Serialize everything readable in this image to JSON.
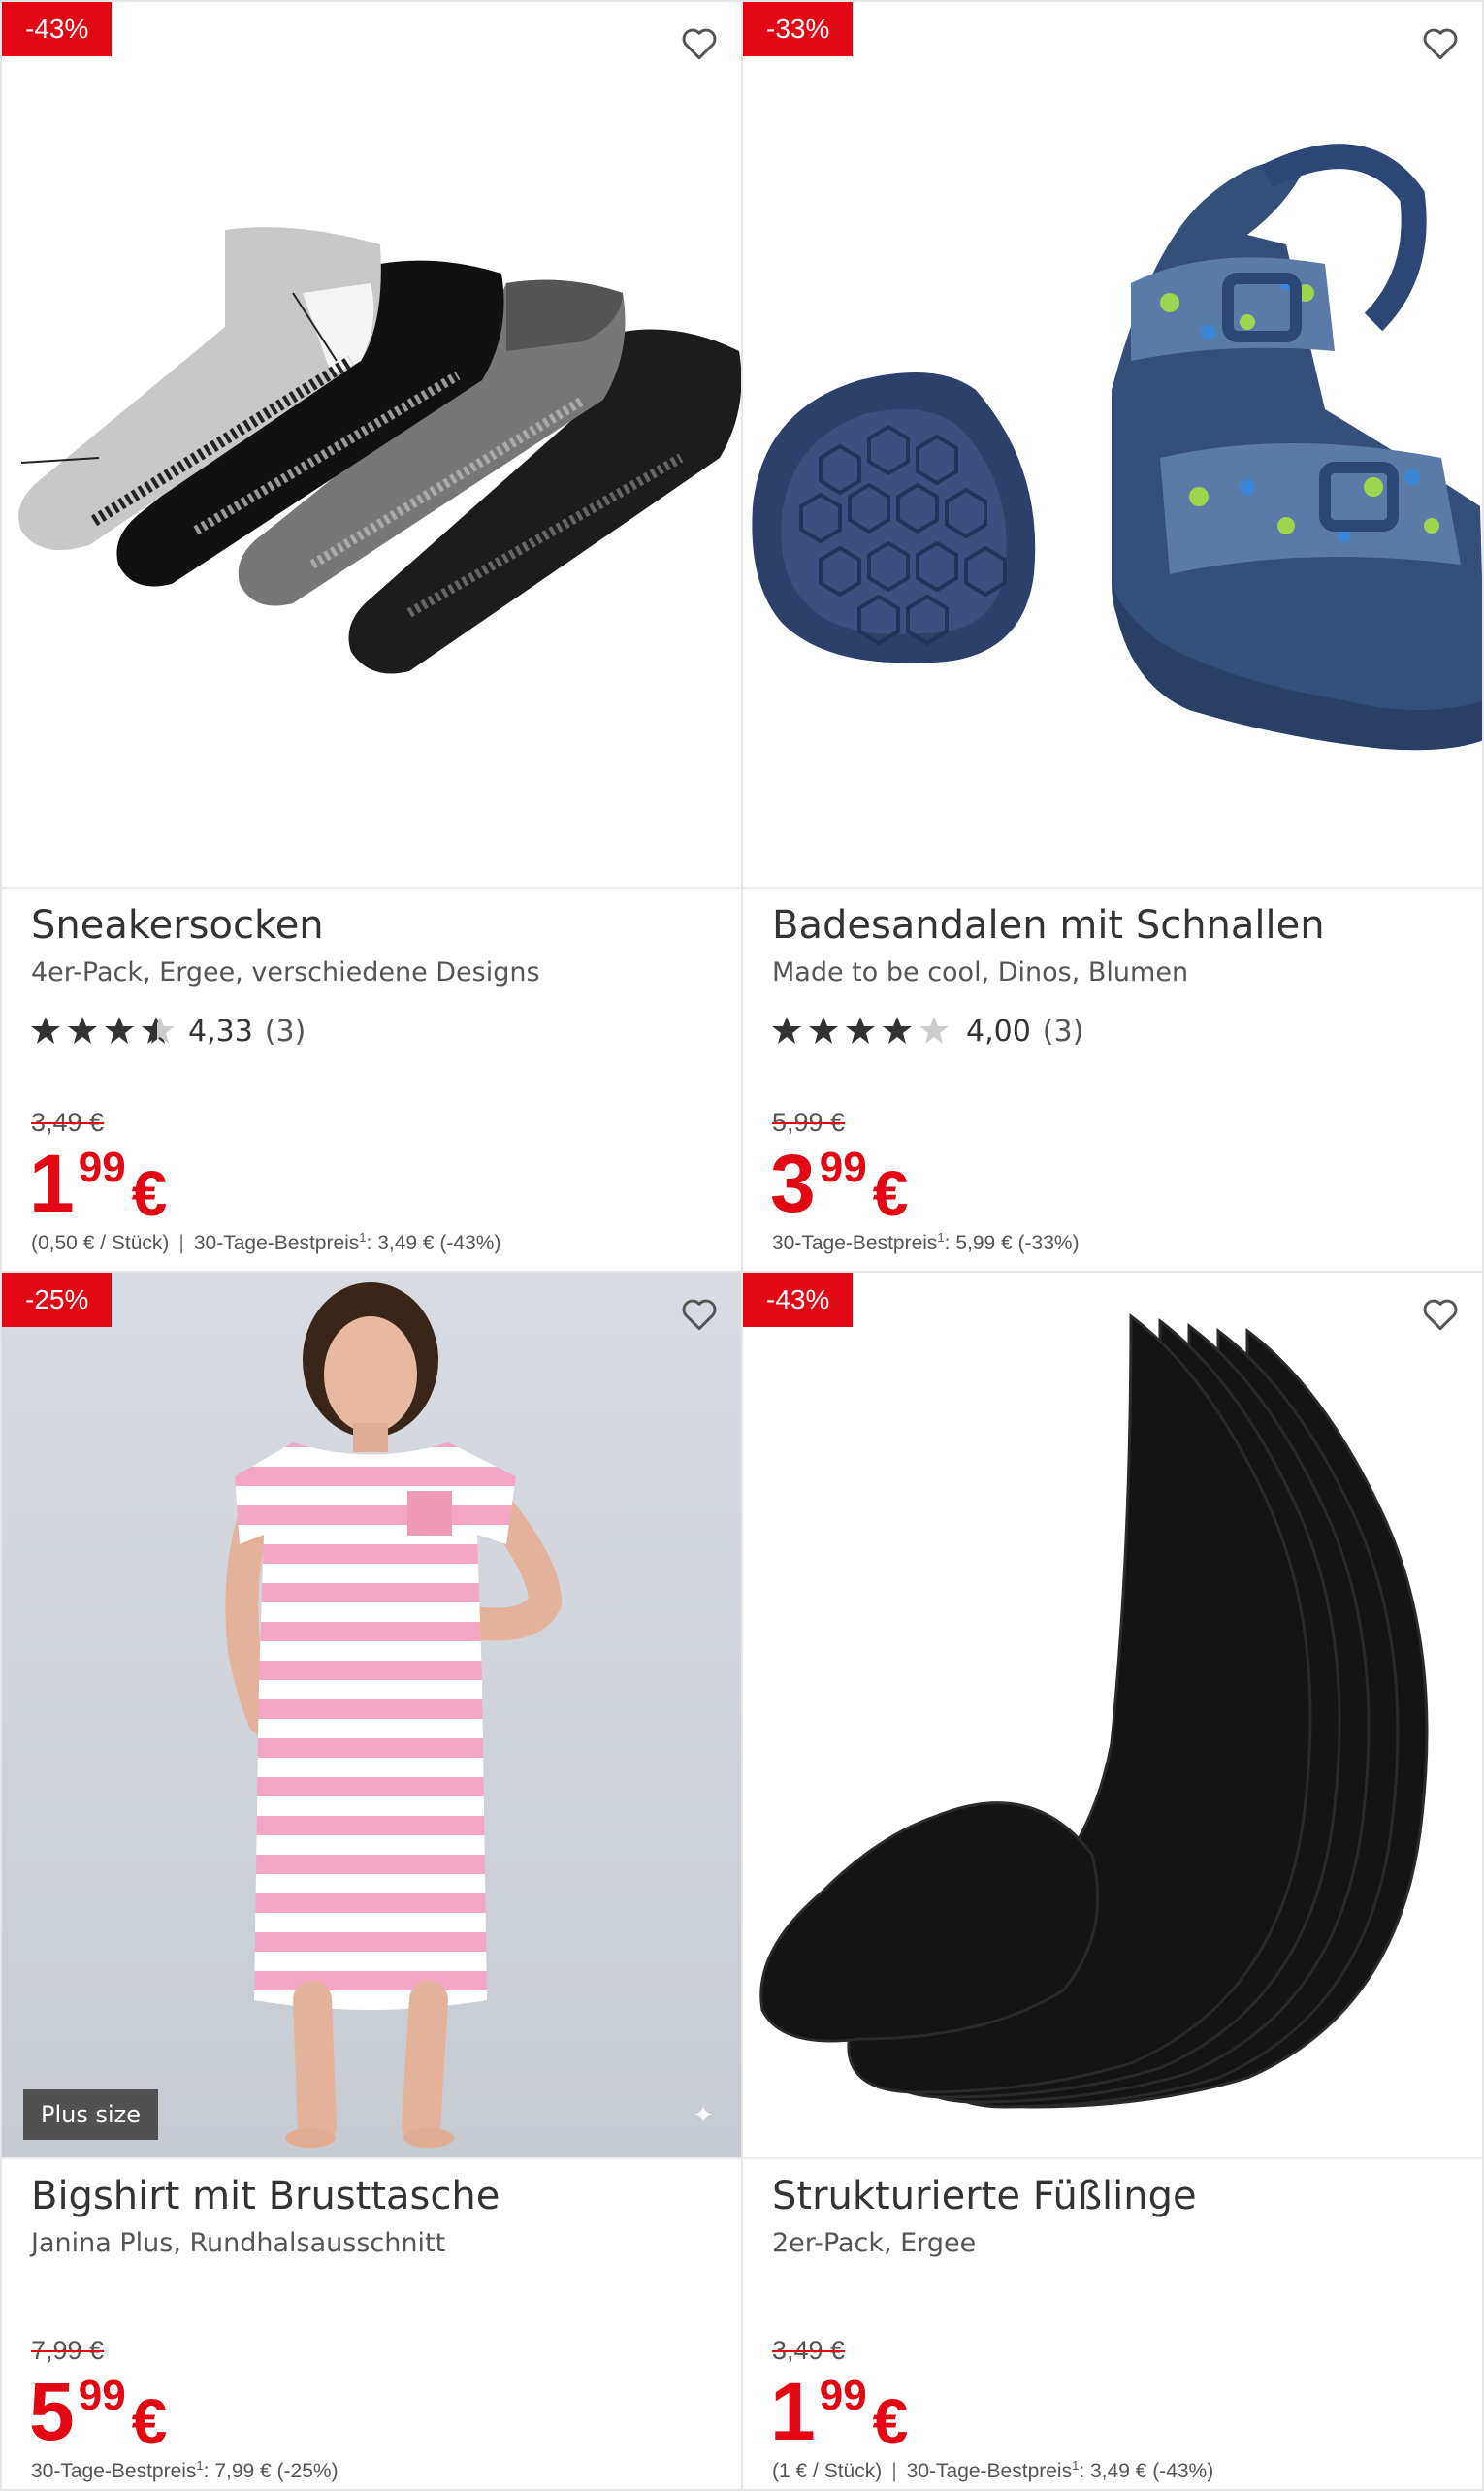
{
  "products": [
    {
      "badge": "-43%",
      "title": "Sneakersocken",
      "subtitle": "4er-Pack, Ergee, verschiedene Designs",
      "rating": {
        "stars": 4.33,
        "value": "4,33",
        "count": "(3)"
      },
      "old_price": "3,49 €",
      "price": {
        "int": "1",
        "dec": "99",
        "cur": "€"
      },
      "unit_price": "(0,50 € / Stück)",
      "best_price_label": "30-Tage-Bestpreis",
      "best_price_value": ": 3,49 € (-43%)"
    },
    {
      "badge": "-33%",
      "title": "Badesandalen mit Schnallen",
      "subtitle": "Made to be cool, Dinos, Blumen",
      "rating": {
        "stars": 4.0,
        "value": "4,00",
        "count": "(3)"
      },
      "old_price": "5,99 €",
      "price": {
        "int": "3",
        "dec": "99",
        "cur": "€"
      },
      "unit_price": "",
      "best_price_label": "30-Tage-Bestpreis",
      "best_price_value": ": 5,99 € (-33%)"
    },
    {
      "badge": "-25%",
      "plus_label": "Plus size",
      "title": "Bigshirt mit Brusttasche",
      "subtitle": "Janina Plus, Rundhalsausschnitt",
      "old_price": "7,99 €",
      "price": {
        "int": "5",
        "dec": "99",
        "cur": "€"
      },
      "unit_price": "",
      "best_price_label": "30-Tage-Bestpreis",
      "best_price_value": ": 7,99 € (-25%)"
    },
    {
      "badge": "-43%",
      "title": "Strukturierte Füßlinge",
      "subtitle": "2er-Pack, Ergee",
      "old_price": "3,49 €",
      "price": {
        "int": "1",
        "dec": "99",
        "cur": "€"
      },
      "unit_price": "(1 € / Stück)",
      "best_price_label": "30-Tage-Bestpreis",
      "best_price_value": ": 3,49 € (-43%)"
    }
  ],
  "footnote_mark": "1",
  "colors": {
    "accent": "#e30613",
    "text": "#333333",
    "border": "#e6e6e6"
  },
  "icons": [
    "heart-icon",
    "star-icon",
    "sparkle-icon"
  ]
}
